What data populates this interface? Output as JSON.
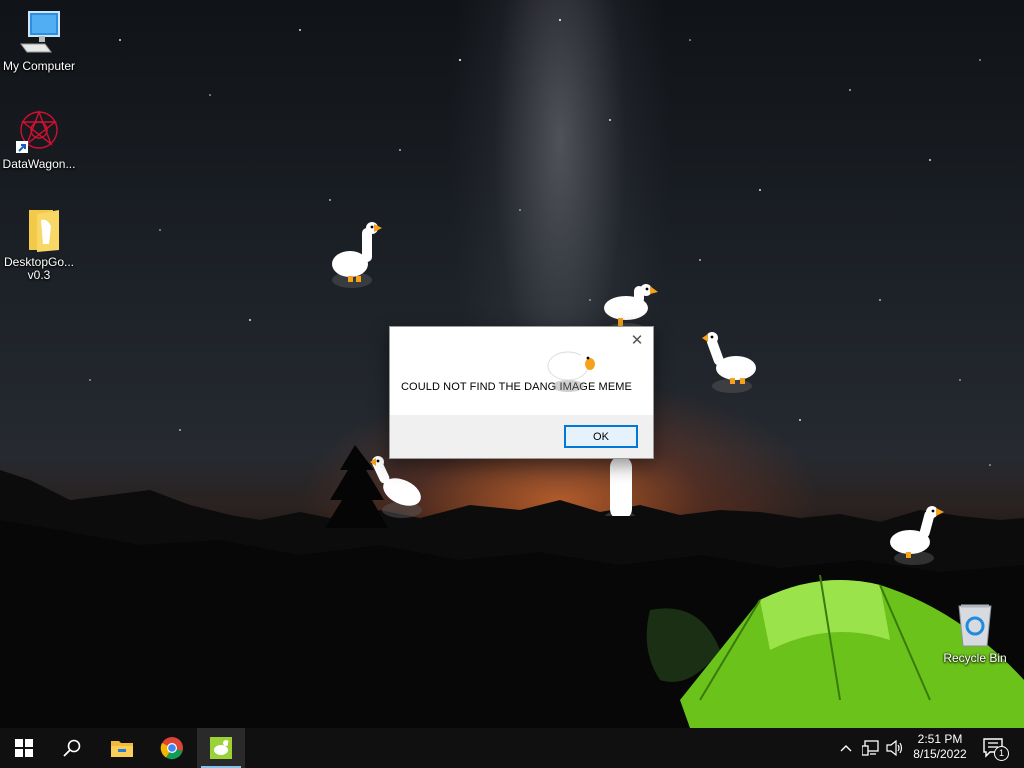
{
  "desktop": {
    "icons": [
      {
        "label": "My Computer",
        "icon": "computer-icon"
      },
      {
        "label": "DataWagon...",
        "icon": "datawagon-icon"
      },
      {
        "label_line1": "DesktopGo...",
        "label_line2": "v0.3",
        "icon": "folder-icon"
      },
      {
        "label": "Recycle Bin",
        "icon": "recycle-bin-icon"
      }
    ]
  },
  "dialog": {
    "message": "COULD NOT FIND THE DANG IMAGE MEME",
    "ok_label": "OK",
    "close_glyph": "✕"
  },
  "taskbar": {
    "clock_time": "2:51 PM",
    "clock_date": "8/15/2022",
    "notification_count": "1",
    "pinned": [
      "start-icon",
      "search-icon",
      "file-explorer-icon",
      "chrome-icon",
      "desktop-goose-icon"
    ]
  },
  "colors": {
    "accent": "#0078d7",
    "taskbar": "#101010",
    "tent": "#7ed321"
  }
}
